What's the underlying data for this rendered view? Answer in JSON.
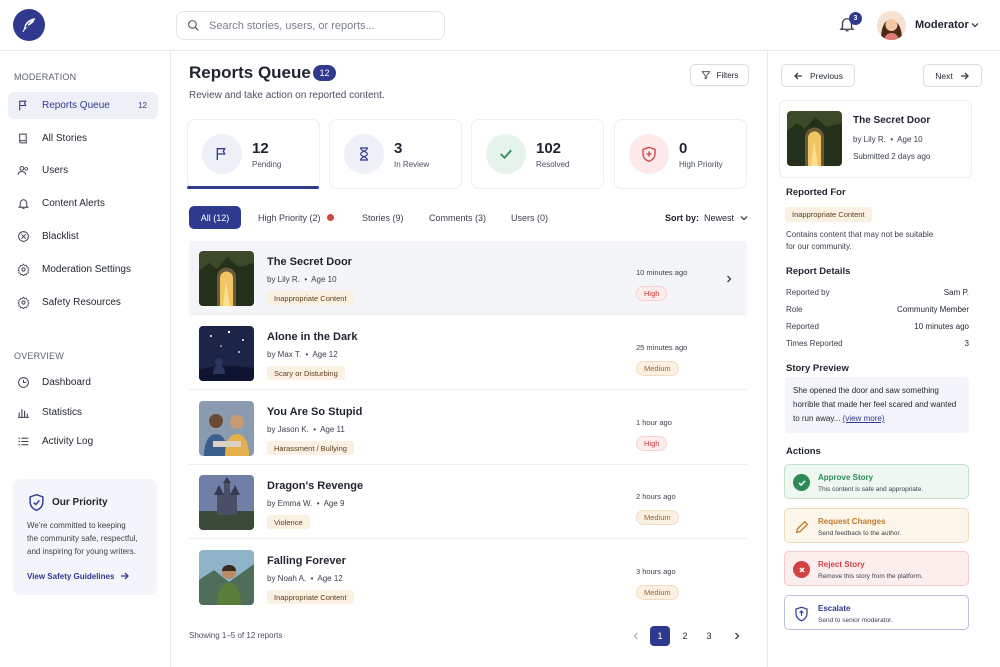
{
  "search": {
    "placeholder": "Search stories, users, or reports..."
  },
  "header": {
    "notification_count": "3",
    "user_name": "Moderator"
  },
  "sidebar": {
    "moderation_heading": "MODERATION",
    "overview_heading": "OVERVIEW",
    "items": [
      {
        "label": "Reports Queue",
        "count": "12",
        "icon": "flag-icon"
      },
      {
        "label": "All Stories",
        "icon": "book-icon"
      },
      {
        "label": "Users",
        "icon": "users-icon"
      },
      {
        "label": "Content Alerts",
        "icon": "bell-icon"
      },
      {
        "label": "Blacklist",
        "icon": "blocked-icon"
      },
      {
        "label": "Moderation Settings",
        "icon": "gear-icon"
      },
      {
        "label": "Safety Resources",
        "icon": "gear-icon"
      }
    ],
    "overview_items": [
      {
        "label": "Dashboard",
        "icon": "clock-icon"
      },
      {
        "label": "Statistics",
        "icon": "bar-chart-icon"
      },
      {
        "label": "Activity Log",
        "icon": "list-icon"
      }
    ],
    "priority": {
      "title": "Our Priority",
      "lines": [
        "We're committed to keeping",
        "the community safe, respectful,",
        "and inspiring for young writers."
      ],
      "link": "View Safety Guidelines"
    }
  },
  "main": {
    "title": "Reports Queue",
    "count": "12",
    "subtitle": "Review and take action on reported content.",
    "filters_label": "Filters",
    "stats": [
      {
        "value": "12",
        "label": "Pending",
        "icon": "flag-icon",
        "color": "#2f3a8f"
      },
      {
        "value": "3",
        "label": "In Review",
        "icon": "hourglass-icon",
        "color": "#2f3a8f"
      },
      {
        "value": "102",
        "label": "Resolved",
        "icon": "check-icon",
        "color": "#2e8b57"
      },
      {
        "value": "0",
        "label": "High Priority",
        "icon": "shield-icon",
        "color": "#d14343"
      }
    ],
    "tabs": [
      "All (12)",
      "High Priority (2)",
      "Stories (9)",
      "Comments (3)",
      "Users (0)"
    ],
    "sort_label": "Sort by:",
    "sort_value": "Newest",
    "reports": [
      {
        "title": "The Secret Door",
        "author": "by Lily R.",
        "age": "Age 10",
        "tag": "Inappropriate Content",
        "time": "10 minutes ago",
        "severity": "High"
      },
      {
        "title": "Alone in the Dark",
        "author": "by Max T.",
        "age": "Age 12",
        "tag": "Scary or Disturbing",
        "time": "25 minutes ago",
        "severity": "Medium"
      },
      {
        "title": "You Are So Stupid",
        "author": "by Jason K.",
        "age": "Age 11",
        "tag": "Harassment / Bullying",
        "time": "1 hour ago",
        "severity": "High"
      },
      {
        "title": "Dragon's Revenge",
        "author": "by Emma W.",
        "age": "Age 9",
        "tag": "Violence",
        "time": "2 hours ago",
        "severity": "Medium"
      },
      {
        "title": "Falling Forever",
        "author": "by Noah A.",
        "age": "Age 12",
        "tag": "Inappropriate Content",
        "time": "3 hours ago",
        "severity": "Medium"
      }
    ],
    "showing": "Showing 1–5 of 12 reports",
    "pages": [
      "1",
      "2",
      "3"
    ]
  },
  "detail": {
    "prev_label": "Previous",
    "next_label": "Next",
    "title": "The Secret Door",
    "author": "by Lily R.",
    "age": "Age 10",
    "submitted": "Submitted 2 days ago",
    "reported_for_heading": "Reported For",
    "reported_for_tag": "Inappropriate Content",
    "reported_for_desc_1": "Contains content that may not be suitable",
    "reported_for_desc_2": "for our community.",
    "details_heading": "Report Details",
    "details": [
      {
        "key": "Reported by",
        "value": "Sam P."
      },
      {
        "key": "Role",
        "value": "Community Member"
      },
      {
        "key": "Reported",
        "value": "10 minutes ago"
      },
      {
        "key": "Times Reported",
        "value": "3"
      }
    ],
    "preview_heading": "Story Preview",
    "preview_text": "She opened the door and saw something horrible that made her feel scared and wanted to run away...",
    "preview_link": "(view more)",
    "actions_heading": "Actions",
    "actions": [
      {
        "title": "Approve Story",
        "desc": "This content is safe and appropriate.",
        "color": "#2e8b57"
      },
      {
        "title": "Request Changes",
        "desc": "Send feedback to the author.",
        "color": "#c07a2c"
      },
      {
        "title": "Reject Story",
        "desc": "Remove this story from the platform.",
        "color": "#d14343"
      },
      {
        "title": "Escalate",
        "desc": "Send to senior moderator.",
        "color": "#2f3a8f"
      }
    ]
  }
}
